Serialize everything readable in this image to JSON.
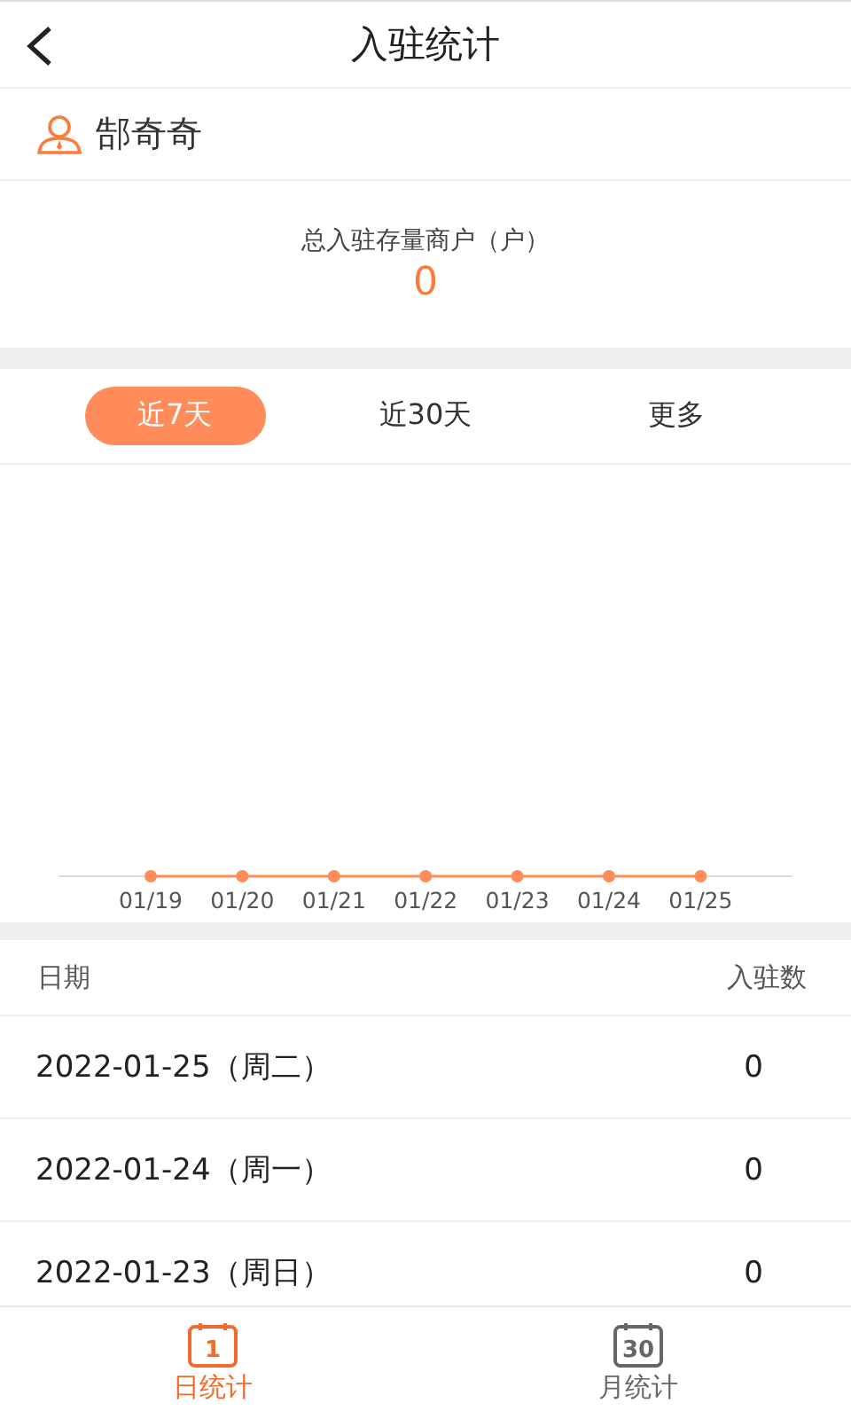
{
  "header": {
    "title": "入驻统计"
  },
  "user": {
    "name": "郜奇奇"
  },
  "summary": {
    "label": "总入驻存量商户（户）",
    "value": "0"
  },
  "tabs": [
    {
      "label": "近7天",
      "selected": true
    },
    {
      "label": "近30天",
      "selected": false
    },
    {
      "label": "更多",
      "selected": false
    }
  ],
  "chart": {
    "x_labels": [
      "01/19",
      "01/20",
      "01/21",
      "01/22",
      "01/23",
      "01/24",
      "01/25"
    ]
  },
  "table": {
    "columns": [
      "日期",
      "入驻数"
    ],
    "rows": [
      {
        "date": "2022-01-25（周二）",
        "count": "0"
      },
      {
        "date": "2022-01-24（周一）",
        "count": "0"
      },
      {
        "date": "2022-01-23（周日）",
        "count": "0"
      }
    ]
  },
  "bottom_nav": [
    {
      "icon_text": "1",
      "label": "日统计",
      "selected": true
    },
    {
      "icon_text": "30",
      "label": "月统计",
      "selected": false
    }
  ]
}
